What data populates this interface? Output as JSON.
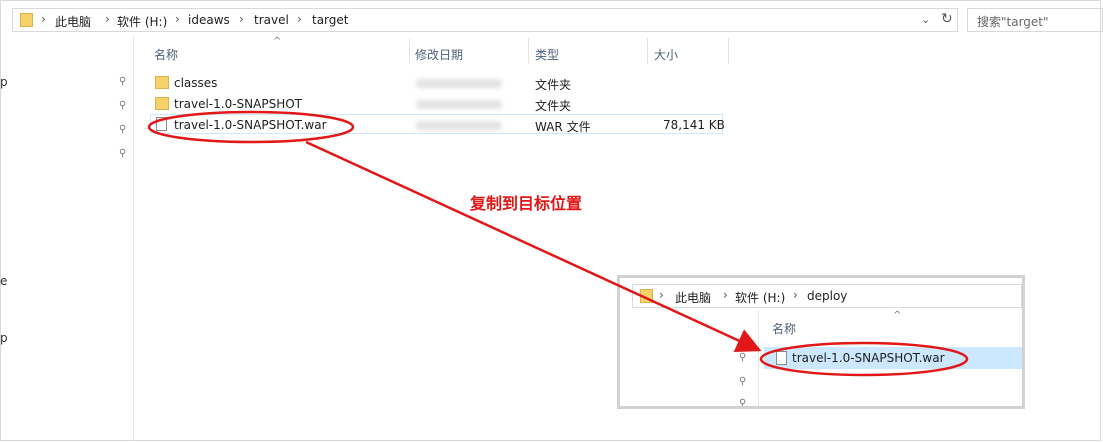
{
  "address": {
    "crumbs": [
      "此电脑",
      "软件 (H:)",
      "ideaws",
      "travel",
      "target"
    ],
    "separator": "›",
    "dropdown": "⌄",
    "refresh": "↻"
  },
  "search": {
    "placeholder": "搜索\"target\""
  },
  "columns": {
    "name": "名称",
    "modified": "修改日期",
    "type": "类型",
    "size": "大小",
    "sort_glyph": "^"
  },
  "nav": {
    "letters": [
      "p",
      "e",
      "p"
    ],
    "pin_glyph": "📌"
  },
  "files": [
    {
      "name": "classes",
      "type": "文件夹",
      "size": "",
      "icon": "folder-icon"
    },
    {
      "name": "travel-1.0-SNAPSHOT",
      "type": "文件夹",
      "size": "",
      "icon": "folder-icon"
    },
    {
      "name": "travel-1.0-SNAPSHOT.war",
      "type": "WAR 文件",
      "size": "78,141 KB",
      "icon": "file-icon"
    }
  ],
  "annotation": {
    "label": "复制到目标位置",
    "color": "#e21717"
  },
  "inset": {
    "crumbs": [
      "此电脑",
      "软件 (H:)",
      "deploy"
    ],
    "column_name": "名称",
    "file": "travel-1.0-SNAPSHOT.war"
  }
}
